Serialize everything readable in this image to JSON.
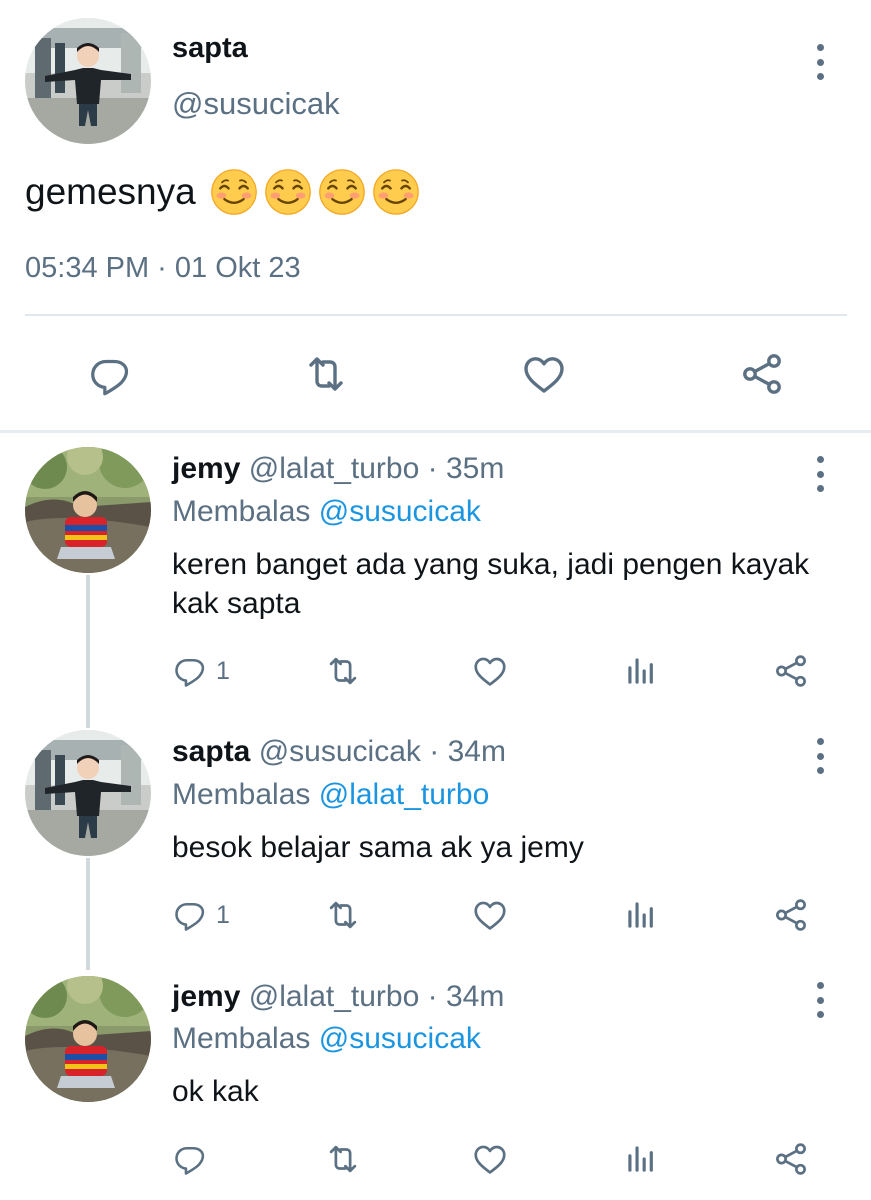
{
  "main_tweet": {
    "author_name": "sapta",
    "author_handle": "@susucicak",
    "text": "gemesnya",
    "emoji_count": 4,
    "timestamp": "05:34 PM · 01 Okt 23",
    "actions": [
      "reply-icon",
      "retweet-icon",
      "like-icon",
      "share-icon"
    ]
  },
  "replies": [
    {
      "name": "jemy",
      "handle": "@lalat_turbo",
      "time": "· 35m",
      "replying_label": "Membalas",
      "replying_to": "@susucicak",
      "text": "keren banget ada yang suka, jadi pengen kayak kak sapta",
      "reply_count": "1"
    },
    {
      "name": "sapta",
      "handle": "@susucicak",
      "time": "· 34m",
      "replying_label": "Membalas",
      "replying_to": "@lalat_turbo",
      "text": "besok belajar sama ak ya jemy",
      "reply_count": "1"
    },
    {
      "name": "jemy",
      "handle": "@lalat_turbo",
      "time": "· 34m",
      "replying_label": "Membalas",
      "replying_to": "@susucicak",
      "text": "ok kak",
      "reply_count": ""
    }
  ],
  "colors": {
    "text_primary": "#0f1419",
    "text_secondary": "#5b7083",
    "mention": "#1b95e0",
    "divider": "#e1e8ed",
    "thread_line": "#cfd9de"
  }
}
